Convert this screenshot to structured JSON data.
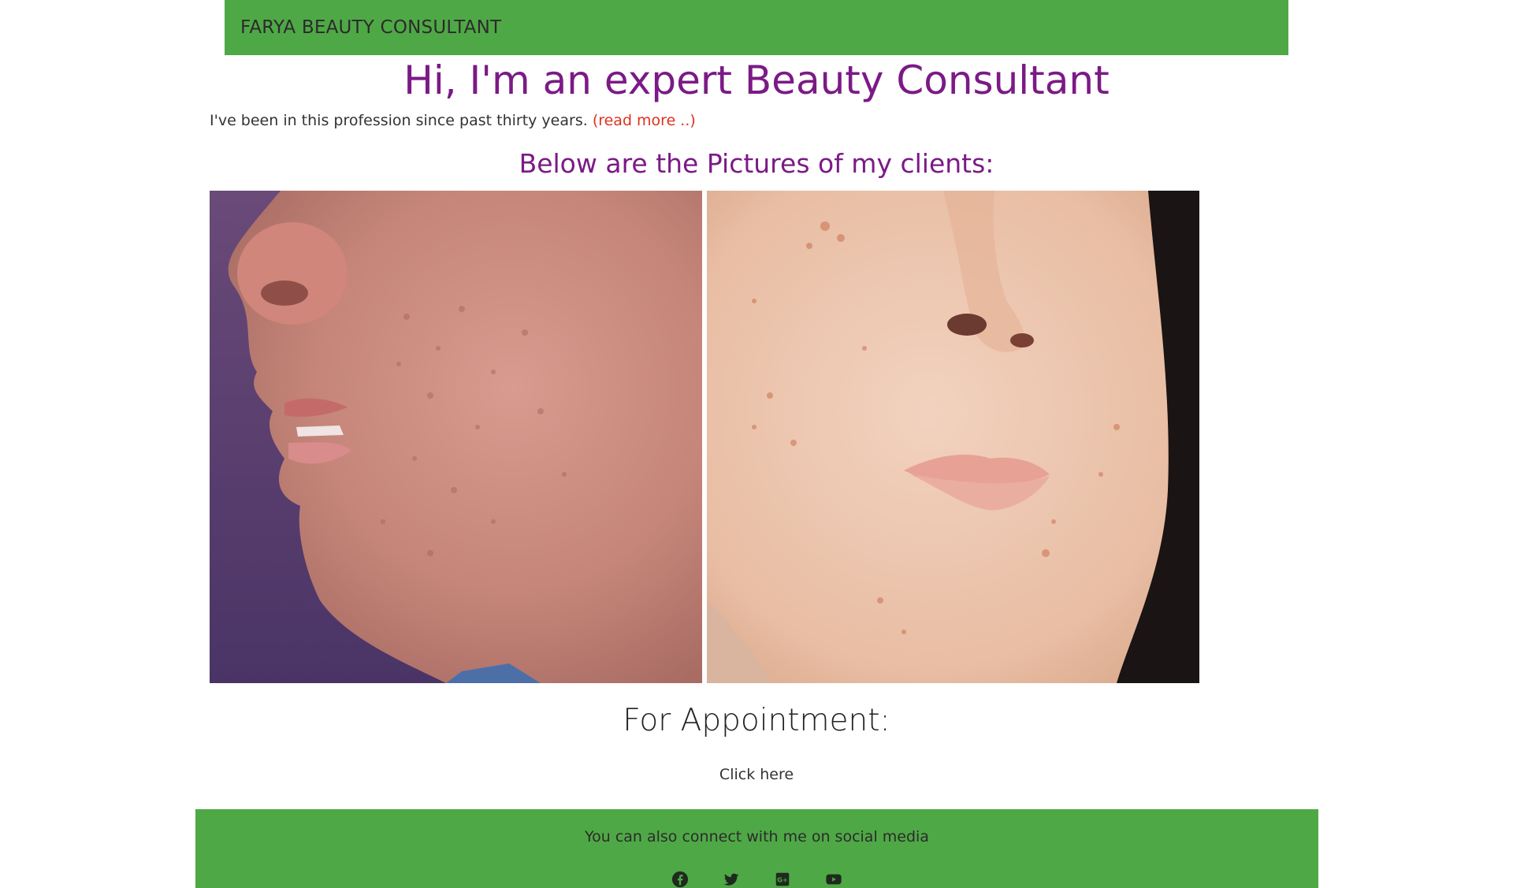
{
  "navbar": {
    "brand": "FARYA BEAUTY CONSULTANT"
  },
  "hero": {
    "title": "Hi, I'm an expert Beauty Consultant",
    "intro": "I've been in this profession since past thirty years.",
    "read_more": "(read more ..)"
  },
  "clients": {
    "heading": "Below are the Pictures of my clients:"
  },
  "appointment": {
    "heading": "For Appointment:",
    "link": "Click here"
  },
  "footer": {
    "text": "You can also connect with me on social media",
    "icons": [
      "facebook-icon",
      "twitter-icon",
      "google-plus-icon",
      "youtube-icon"
    ]
  },
  "colors": {
    "nav_green": "#4fa846",
    "heading_purple": "#7b1a86",
    "link_red": "#e0301e"
  }
}
